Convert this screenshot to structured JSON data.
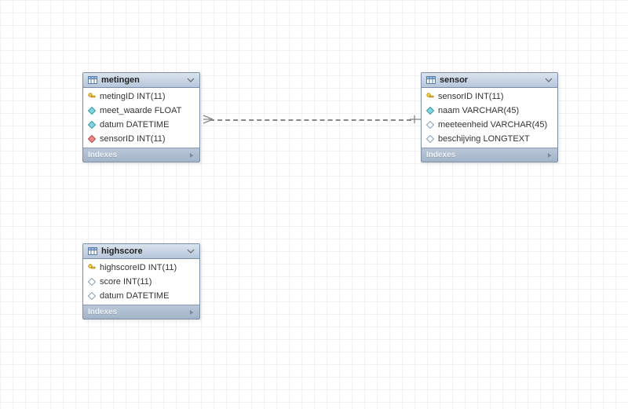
{
  "tables": {
    "metingen": {
      "name": "metingen",
      "indexes_label": "Indexes",
      "columns": [
        {
          "label": "metingID INT(11)",
          "icon": "key"
        },
        {
          "label": "meet_waarde FLOAT",
          "icon": "filled-cyan"
        },
        {
          "label": "datum DATETIME",
          "icon": "filled-cyan"
        },
        {
          "label": "sensorID INT(11)",
          "icon": "filled-red"
        }
      ]
    },
    "sensor": {
      "name": "sensor",
      "indexes_label": "Indexes",
      "columns": [
        {
          "label": "sensorID INT(11)",
          "icon": "key"
        },
        {
          "label": "naam VARCHAR(45)",
          "icon": "filled-cyan"
        },
        {
          "label": "meeteenheid VARCHAR(45)",
          "icon": "open"
        },
        {
          "label": "beschijving LONGTEXT",
          "icon": "open"
        }
      ]
    },
    "highscore": {
      "name": "highscore",
      "indexes_label": "Indexes",
      "columns": [
        {
          "label": "highscoreID INT(11)",
          "icon": "key"
        },
        {
          "label": "score INT(11)",
          "icon": "open"
        },
        {
          "label": "datum DATETIME",
          "icon": "open"
        }
      ]
    }
  }
}
